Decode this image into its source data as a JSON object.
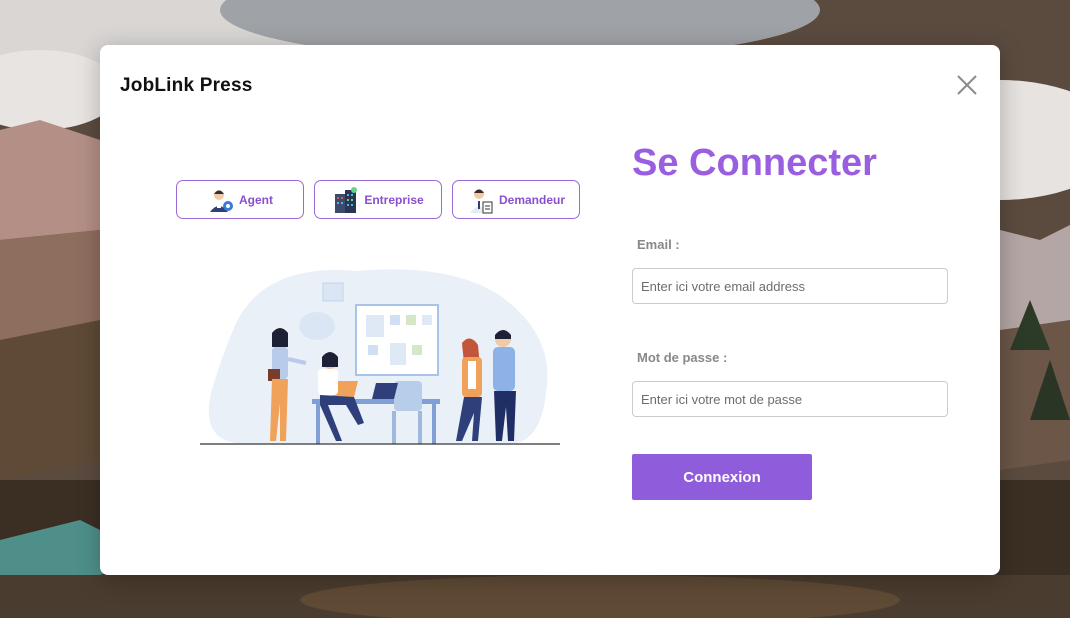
{
  "app": {
    "brand": "JobLink Press"
  },
  "roles": [
    {
      "label": "Agent",
      "icon": "agent-icon"
    },
    {
      "label": "Entreprise",
      "icon": "building-icon"
    },
    {
      "label": "Demandeur",
      "icon": "job-seeker-icon"
    }
  ],
  "login": {
    "title": "Se Connecter",
    "email_label": "Email :",
    "email_placeholder": "Enter ici votre email address",
    "password_label": "Mot de passe :",
    "password_placeholder": "Enter ici votre mot de passe",
    "submit_label": "Connexion"
  },
  "colors": {
    "accent": "#8f5ddb",
    "title": "#9a5ee0",
    "role_border": "#9b6ad6"
  }
}
